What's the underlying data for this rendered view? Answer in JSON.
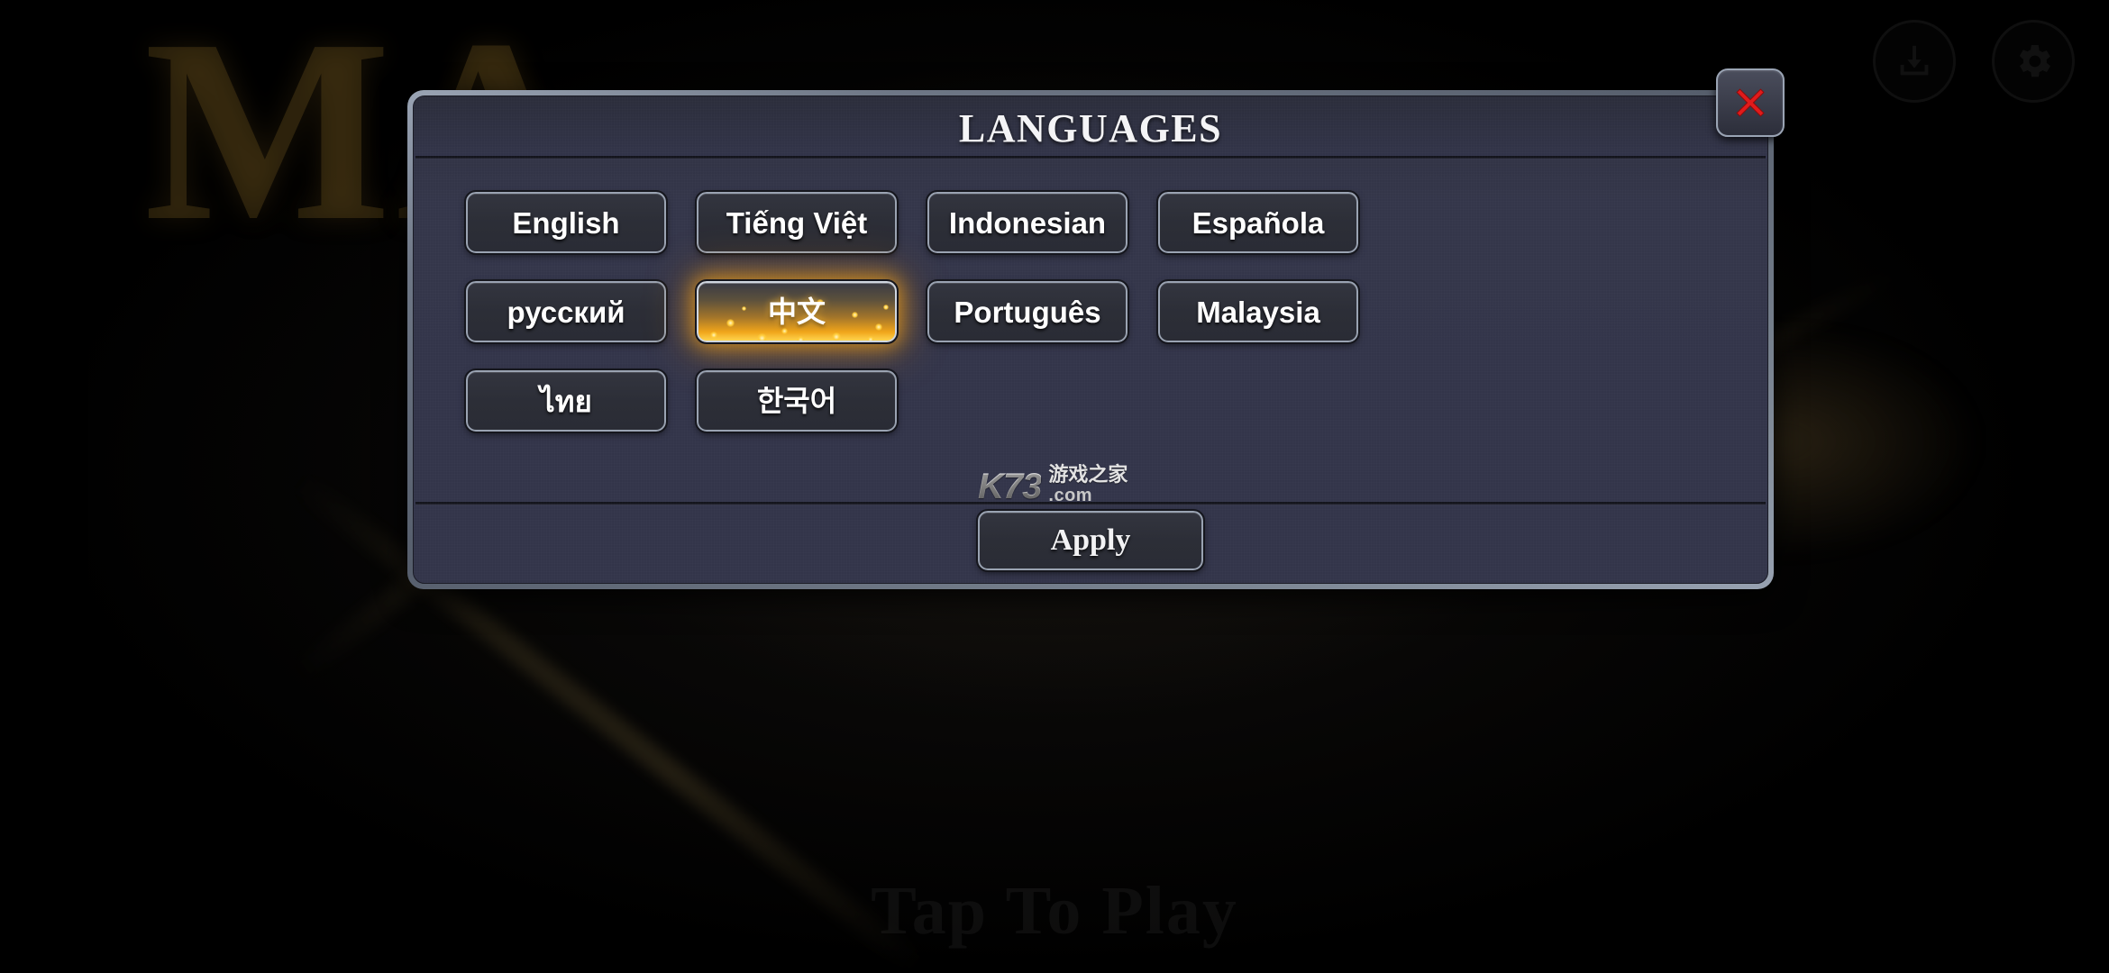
{
  "background": {
    "logo_text": "MA",
    "tagline": "Tap To Play",
    "top_icons": [
      {
        "name": "download-icon",
        "label": "Download"
      },
      {
        "name": "gear-icon",
        "label": "Settings"
      }
    ]
  },
  "dialog": {
    "title": "LANGUAGES",
    "close_label": "×",
    "languages": [
      {
        "label": "English",
        "selected": false,
        "script": "latin"
      },
      {
        "label": "Tiếng Việt",
        "selected": false,
        "script": "latin"
      },
      {
        "label": "Indonesian",
        "selected": false,
        "script": "latin"
      },
      {
        "label": "Española",
        "selected": false,
        "script": "latin"
      },
      {
        "label": "русский",
        "selected": false,
        "script": "cyrillic"
      },
      {
        "label": "中文",
        "selected": true,
        "script": "cjk"
      },
      {
        "label": "Português",
        "selected": false,
        "script": "latin"
      },
      {
        "label": "Malaysia",
        "selected": false,
        "script": "latin"
      },
      {
        "label": "ไทย",
        "selected": false,
        "script": "thai"
      },
      {
        "label": "한국어",
        "selected": false,
        "script": "cjk"
      }
    ],
    "apply_label": "Apply"
  },
  "watermark": {
    "brand": "K73",
    "chinese": "游戏之家",
    "domain": ".com"
  },
  "colors": {
    "dialog_border": "#9aa4b4",
    "dialog_fill": "#33354a",
    "button_border": "#9aa3b2",
    "button_fill": "#2c2e37",
    "selected_gold": "#ffaa14",
    "close_red": "#e01b1b",
    "text_white": "#ffffff"
  }
}
